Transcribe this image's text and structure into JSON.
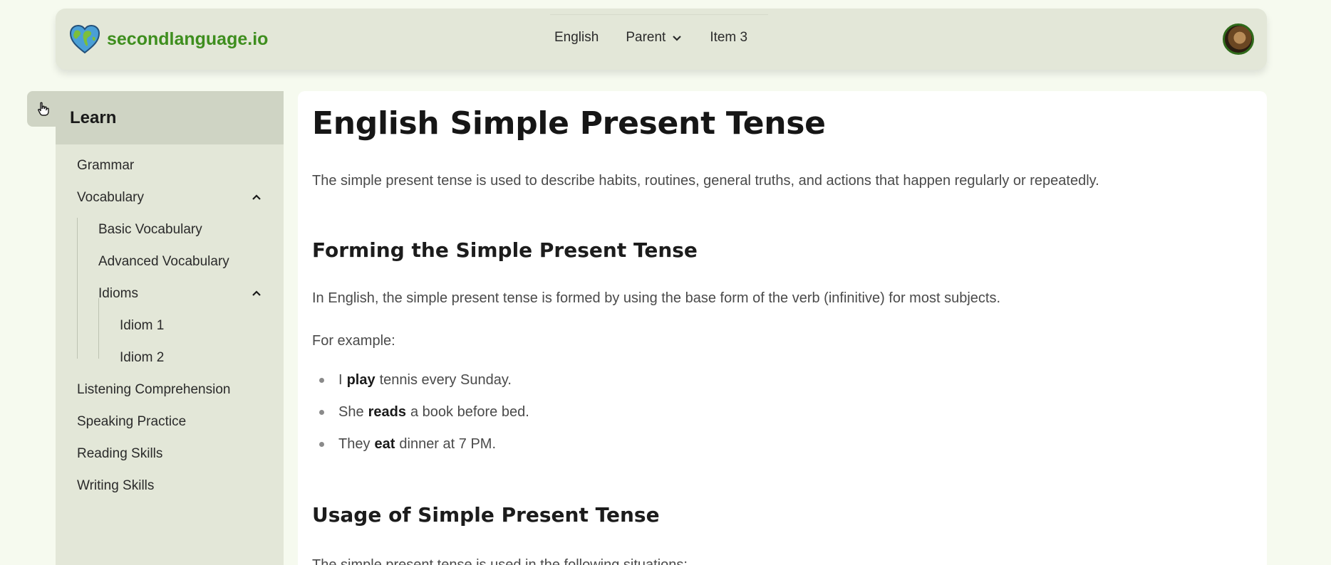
{
  "header": {
    "brand": "secondlanguage.io",
    "menu": [
      {
        "label": "English"
      },
      {
        "label": "Parent"
      },
      {
        "label": "Item 3"
      }
    ]
  },
  "sidebar": {
    "title": "Learn",
    "items": [
      {
        "label": "Grammar"
      },
      {
        "label": "Vocabulary"
      },
      {
        "label": "Basic Vocabulary"
      },
      {
        "label": "Advanced Vocabulary"
      },
      {
        "label": "Idioms"
      },
      {
        "label": "Idiom 1"
      },
      {
        "label": "Idiom 2"
      },
      {
        "label": "Listening Comprehension"
      },
      {
        "label": "Speaking Practice"
      },
      {
        "label": "Reading Skills"
      },
      {
        "label": "Writing Skills"
      }
    ]
  },
  "article": {
    "title": "English Simple Present Tense",
    "intro": "The simple present tense is used to describe habits, routines, general truths, and actions that happen regularly or repeatedly.",
    "section1": {
      "heading": "Forming the Simple Present Tense",
      "text": "In English, the simple present tense is formed by using the base form of the verb (infinitive) for most subjects.",
      "example_label": "For example:",
      "examples": [
        {
          "before": "I",
          "verb": "play",
          "after": "tennis every Sunday."
        },
        {
          "before": "She",
          "verb": "reads",
          "after": "a book before bed."
        },
        {
          "before": "They",
          "verb": "eat",
          "after": "dinner at 7 PM."
        }
      ]
    },
    "section2": {
      "heading": "Usage of Simple Present Tense",
      "text": "The simple present tense is used in the following situations:"
    }
  }
}
